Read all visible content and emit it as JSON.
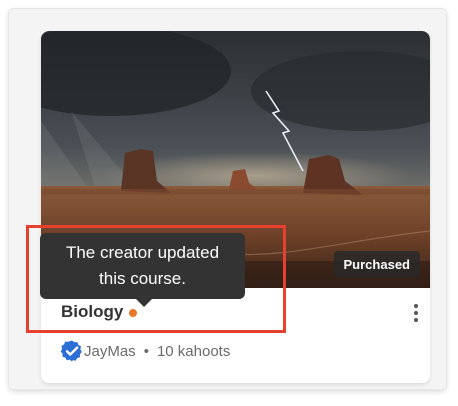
{
  "card": {
    "badge": "Purchased",
    "title": "Biology",
    "creator": "JayMas",
    "separator": "•",
    "kahoots": "10 kahoots",
    "updated_dot_color": "#e8782a",
    "verified_color": "#2b6ed6"
  },
  "tooltip": {
    "line1": "The creator updated",
    "line2": "this course."
  },
  "highlight": {
    "color": "#e8402f"
  },
  "icons": {
    "more": "more-vertical-icon",
    "verified": "verified-badge-icon"
  }
}
